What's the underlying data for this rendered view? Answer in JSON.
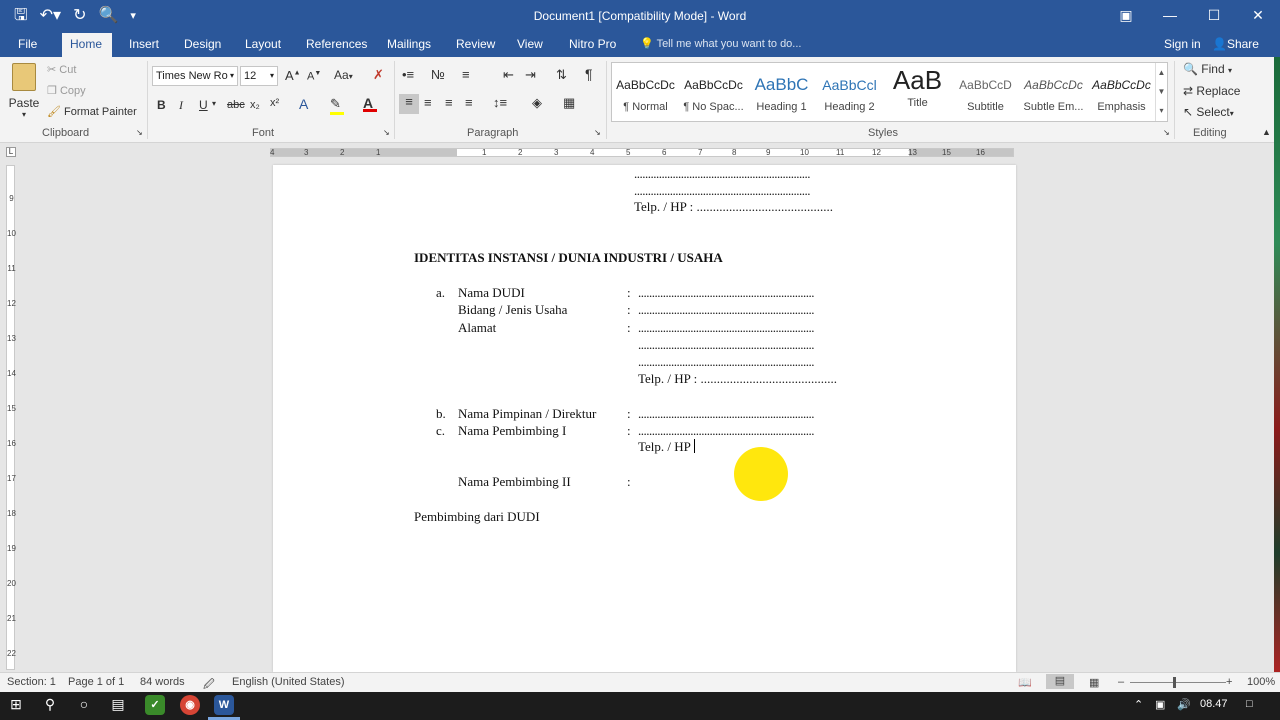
{
  "window": {
    "title": "Document1 [Compatibility Mode] - Word",
    "qat_icons": [
      "save-icon",
      "undo-icon",
      "redo-icon",
      "print-preview-icon",
      "customize-icon"
    ],
    "win_controls": [
      "ribbon-display-icon",
      "minimize-icon",
      "maximize-icon",
      "close-icon"
    ]
  },
  "tabs": {
    "file": "File",
    "items": [
      "Home",
      "Insert",
      "Design",
      "Layout",
      "References",
      "Mailings",
      "Review",
      "View",
      "Nitro Pro"
    ],
    "active": "Home",
    "tell_me": "Tell me what you want to do...",
    "sign_in": "Sign in",
    "share": "Share"
  },
  "ribbon": {
    "clipboard": {
      "label": "Clipboard",
      "paste": "Paste",
      "cut": "Cut",
      "copy": "Copy",
      "format_painter": "Format Painter"
    },
    "font": {
      "label": "Font",
      "font_name": "Times New Ro",
      "font_size": "12",
      "bold": "B",
      "italic": "I",
      "underline": "U",
      "strike": "abc",
      "subscript": "x₂",
      "superscript": "x²",
      "change_case": "Aa",
      "font_color_letter": "A"
    },
    "paragraph": {
      "label": "Paragraph",
      "pilcrow": "¶"
    },
    "styles": {
      "label": "Styles",
      "items": [
        {
          "preview": "AaBbCcDc",
          "name": "¶ Normal"
        },
        {
          "preview": "AaBbCcDc",
          "name": "¶ No Spac..."
        },
        {
          "preview": "AaBbC",
          "name": "Heading 1"
        },
        {
          "preview": "AaBbCcl",
          "name": "Heading 2"
        },
        {
          "preview": "AaB",
          "name": "Title"
        },
        {
          "preview": "AaBbCcD",
          "name": "Subtitle"
        },
        {
          "preview": "AaBbCcDc",
          "name": "Subtle Em..."
        },
        {
          "preview": "AaBbCcDc",
          "name": "Emphasis"
        }
      ]
    },
    "editing": {
      "label": "Editing",
      "find": "Find",
      "replace": "Replace",
      "select": "Select"
    }
  },
  "ruler": {
    "h_labels": [
      "4",
      "3",
      "2",
      "1",
      "1",
      "2",
      "3",
      "4",
      "5",
      "6",
      "7",
      "8",
      "9",
      "10",
      "11",
      "12",
      "13",
      "15",
      "16"
    ],
    "v_labels": [
      "9",
      "10",
      "11",
      "12",
      "13",
      "14",
      "15",
      "16",
      "17",
      "18",
      "19",
      "20",
      "21",
      "22"
    ]
  },
  "document": {
    "dots_long": "................................................................",
    "telp_top": "Telp. / HP  :  ..........................................",
    "heading": "IDENTITAS INSTANSI / DUNIA INDUSTRI / USAHA",
    "a": "a.",
    "nama_dudi": "Nama DUDI",
    "bidang": "Bidang / Jenis Usaha",
    "alamat": "Alamat",
    "colon": ":",
    "telp_mid": "Telp. / HP  :  ..........................................",
    "b": "b.",
    "nama_pimpinan": "Nama Pimpinan / Direktur",
    "c": "c.",
    "nama_pembimbing_1": "Nama Pembimbing I",
    "telp_current": "Telp. / HP",
    "nama_pembimbing_2": "Nama Pembimbing II",
    "pembimbing_dudi": "Pembimbing dari DUDI"
  },
  "status": {
    "section": "Section: 1",
    "page": "Page 1 of 1",
    "words": "84 words",
    "language": "English (United States)",
    "zoom": "100%"
  },
  "taskbar": {
    "time": "08.47"
  }
}
